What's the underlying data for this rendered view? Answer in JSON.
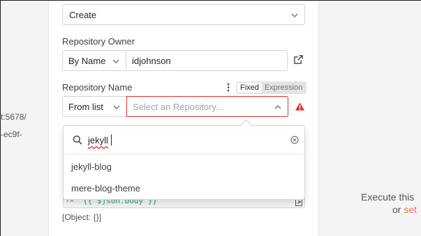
{
  "background_left": {
    "line1": "t:5678/",
    "line2": "-ec9f-"
  },
  "background_right": {
    "line1": "Execute this",
    "line2_prefix": "or ",
    "line2_accent": "set"
  },
  "operation": {
    "value": "Create"
  },
  "repository_owner": {
    "label": "Repository Owner",
    "mode": "By Name",
    "value": "idjohnson"
  },
  "repository_name": {
    "label": "Repository Name",
    "toggle_fixed": "Fixed",
    "toggle_expression": "Expression",
    "mode": "From list",
    "placeholder": "Select an Repository..."
  },
  "dropdown": {
    "search_value": "jekyll",
    "items": [
      "jekyll-blog",
      "mere-blog-theme"
    ]
  },
  "code_field": {
    "value": "{{ $json.body }}",
    "prefix": "fx"
  },
  "object_hint": "[Object: {}]",
  "colors": {
    "warning": "#e0312d",
    "accent": "#f0705a",
    "expression_green": "#22a06b"
  }
}
